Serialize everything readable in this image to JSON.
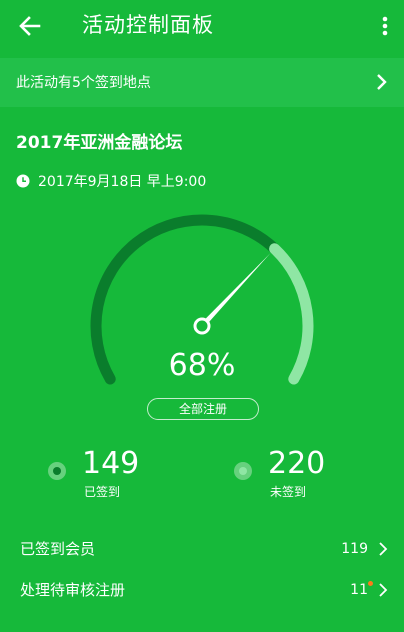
{
  "app_bar": {
    "title": "活动控制面板"
  },
  "banner": {
    "text": "此活动有5个签到地点"
  },
  "event": {
    "title": "2017年亚洲金融论坛",
    "datetime": "2017年9月18日 早上9:00"
  },
  "gauge": {
    "percent_label": "68%",
    "percent_value": 0.68,
    "all_registrations_label": "全部注册"
  },
  "stats": {
    "checked_in": {
      "count": "149",
      "label": "已签到"
    },
    "not_checked_in": {
      "count": "220",
      "label": "未签到"
    }
  },
  "rows": [
    {
      "label": "已签到会员",
      "value": "119"
    },
    {
      "label": "处理待审核注册",
      "value": "11"
    }
  ],
  "colors": {
    "background": "#16b93a",
    "banner": "#22c04a",
    "gauge_filled": "#0a7d2c",
    "gauge_remaining": "#8fe6a4",
    "badge": "#ff7a1a"
  }
}
